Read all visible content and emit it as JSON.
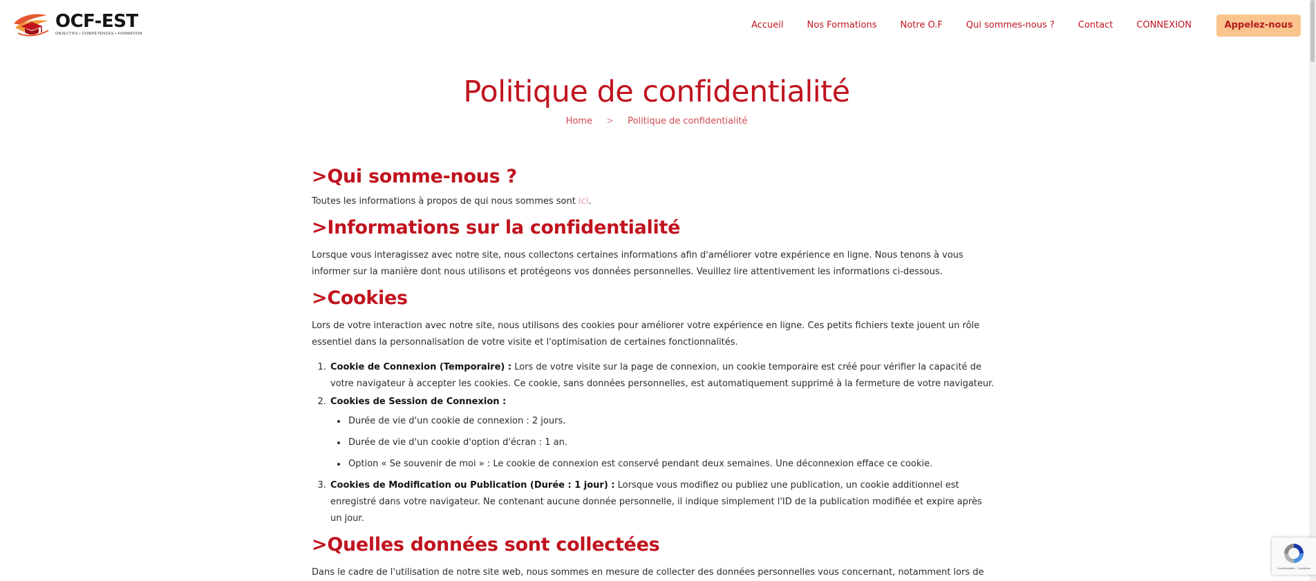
{
  "header": {
    "logo": {
      "name": "OCF-EST",
      "tagline": "OBJECTIFS • COMPÉTENCES • FORMATION"
    },
    "nav": [
      {
        "label": "Accueil"
      },
      {
        "label": "Nos Formations"
      },
      {
        "label": "Notre O.F"
      },
      {
        "label": "Qui sommes-nous ?"
      },
      {
        "label": "Contact"
      },
      {
        "label": "CONNEXION"
      }
    ],
    "cta": "Appelez-nous"
  },
  "page": {
    "title": "Politique de confidentialité",
    "breadcrumb": {
      "home": "Home",
      "separator": ">",
      "current": "Politique de confidentialité"
    }
  },
  "sections": {
    "who": {
      "heading": ">Qui somme-nous ?",
      "text": "Toutes les informations à propos de qui nous sommes sont ",
      "link": "ici",
      "after": "."
    },
    "privacy": {
      "heading": ">Informations sur la confidentialité",
      "text": "Lorsque vous interagissez avec notre site, nous collectons certaines informations afin d'améliorer votre expérience en ligne. Nous tenons à vous informer sur la manière dont nous utilisons et protégeons vos données personnelles. Veuillez lire attentivement les informations ci-dessous."
    },
    "cookies": {
      "heading": ">Cookies",
      "intro": "Lors de votre interaction avec notre site, nous utilisons des cookies pour améliorer votre expérience en ligne. Ces petits fichiers texte jouent un rôle essentiel dans la personnalisation de votre visite et l'optimisation de certaines fonctionnalités.",
      "items": [
        {
          "title": "Cookie de Connexion (Temporaire) :",
          "text": " Lors de votre visite sur la page de connexion, un cookie temporaire est créé pour vérifier la capacité de votre navigateur à accepter les cookies. Ce cookie, sans données personnelles, est automatiquement supprimé à la fermeture de votre navigateur."
        },
        {
          "title": "Cookies de Session de Connexion :",
          "sub": [
            "Durée de vie d'un cookie de connexion : 2 jours.",
            "Durée de vie d'un cookie d'option d'écran : 1 an.",
            "Option « Se souvenir de moi » : Le cookie de connexion est conservé pendant deux semaines. Une déconnexion efface ce cookie."
          ]
        },
        {
          "title": "Cookies de Modification ou Publication (Durée : 1 jour) :",
          "text": " Lorsque vous modifiez ou publiez une publication, un cookie additionnel est enregistré dans votre navigateur. Ne contenant aucune donnée personnelle, il indique simplement l'ID de la publication modifiée et expire après un jour."
        }
      ]
    },
    "data": {
      "heading": ">Quelles données sont collectées",
      "text": "Dans le cadre de l'utilisation de notre site web, nous sommes en mesure de collecter des données personnelles vous concernant, notamment lors de votre"
    }
  },
  "recaptcha": {
    "text": "Confidentialité - Conditions"
  },
  "colors": {
    "accent": "#c0131e",
    "cta_bg": "#f9c48d",
    "link": "#e39b9e"
  }
}
